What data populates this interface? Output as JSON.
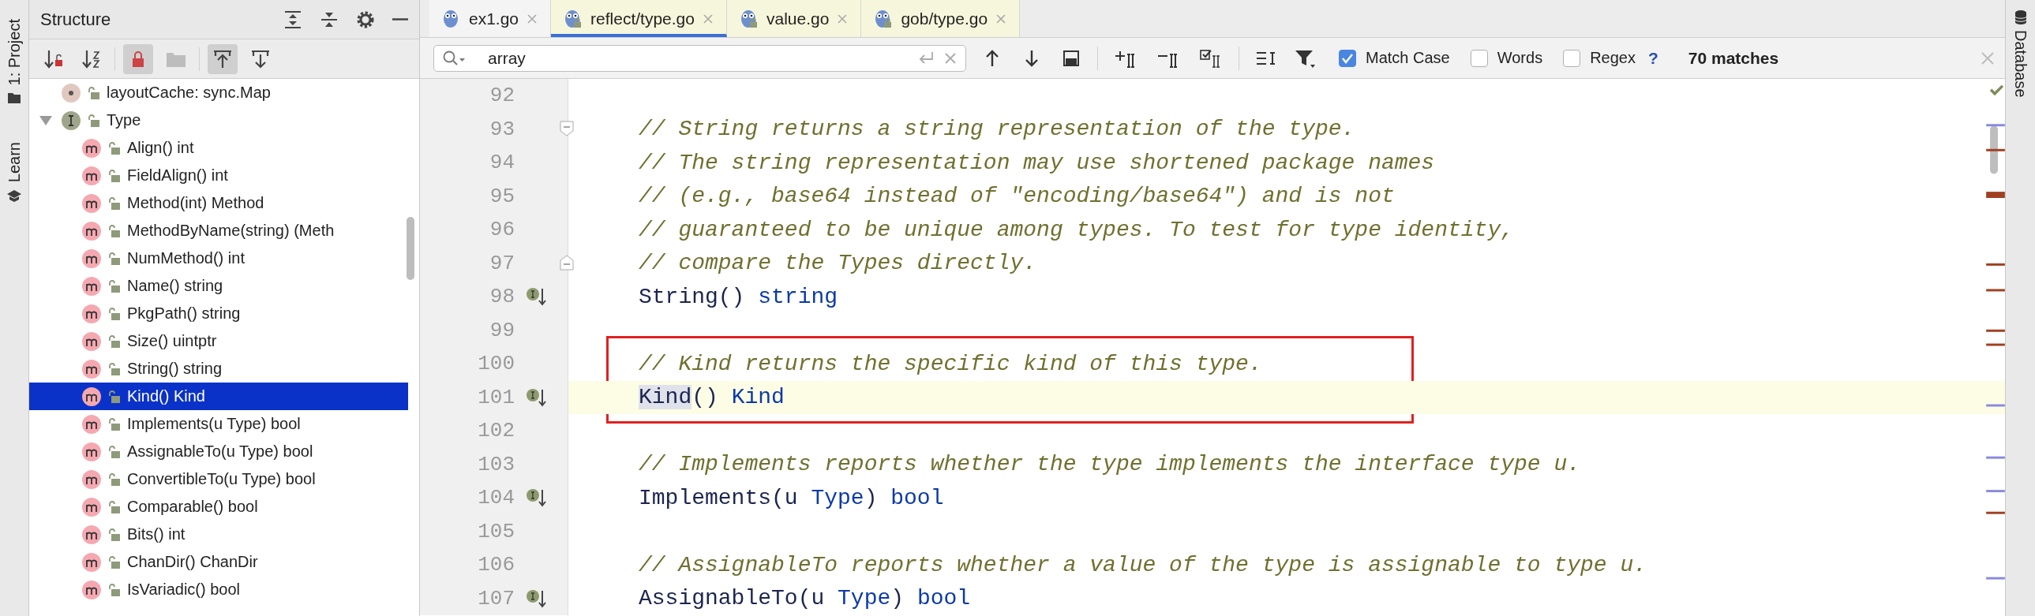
{
  "left_strip": [
    {
      "label": "1: Project",
      "kind": "project"
    },
    {
      "label": "Learn",
      "kind": "learn"
    }
  ],
  "structure": {
    "title": "Structure",
    "toolbar": [
      {
        "kind": "visibility",
        "selected": false
      },
      {
        "kind": "alpha",
        "selected": false
      },
      {
        "kind": "lock",
        "selected": true
      },
      {
        "kind": "folder",
        "selected": false
      },
      {
        "kind": "autoscroll",
        "selected": true
      },
      {
        "kind": "scrollto",
        "selected": false
      }
    ],
    "tree": [
      {
        "label": "layoutCache: sync.Map",
        "kind": "field",
        "selected": false
      },
      {
        "label": "Type",
        "kind": "interface",
        "selected": false,
        "expanded": true,
        "children": [
          {
            "label": "Align() int",
            "kind": "method",
            "selected": false
          },
          {
            "label": "FieldAlign() int",
            "kind": "method",
            "selected": false
          },
          {
            "label": "Method(int) Method",
            "kind": "method",
            "selected": false
          },
          {
            "label": "MethodByName(string) (Meth",
            "kind": "method",
            "selected": false
          },
          {
            "label": "NumMethod() int",
            "kind": "method",
            "selected": false
          },
          {
            "label": "Name() string",
            "kind": "method",
            "selected": false
          },
          {
            "label": "PkgPath() string",
            "kind": "method",
            "selected": false
          },
          {
            "label": "Size() uintptr",
            "kind": "method",
            "selected": false
          },
          {
            "label": "String() string",
            "kind": "method",
            "selected": false
          },
          {
            "label": "Kind() Kind",
            "kind": "method",
            "selected": true
          },
          {
            "label": "Implements(u Type) bool",
            "kind": "method",
            "selected": false
          },
          {
            "label": "AssignableTo(u Type) bool",
            "kind": "method",
            "selected": false
          },
          {
            "label": "ConvertibleTo(u Type) bool",
            "kind": "method",
            "selected": false
          },
          {
            "label": "Comparable() bool",
            "kind": "method",
            "selected": false
          },
          {
            "label": "Bits() int",
            "kind": "method",
            "selected": false
          },
          {
            "label": "ChanDir() ChanDir",
            "kind": "method",
            "selected": false
          },
          {
            "label": "IsVariadic() bool",
            "kind": "method",
            "selected": false
          }
        ]
      }
    ]
  },
  "tabs": [
    {
      "label": "ex1.go",
      "selected": false,
      "read_only": false
    },
    {
      "label": "reflect/type.go",
      "selected": true,
      "read_only": true
    },
    {
      "label": "value.go",
      "selected": false,
      "read_only": true
    },
    {
      "label": "gob/type.go",
      "selected": false,
      "read_only": true
    }
  ],
  "search": {
    "value": "array",
    "options": [
      {
        "label": "Match Case",
        "checked": true
      },
      {
        "label": "Words",
        "checked": false
      },
      {
        "label": "Regex",
        "checked": false
      }
    ],
    "help": "?",
    "matches": "70 matches"
  },
  "editor": {
    "lines": [
      {
        "number": "92"
      },
      {
        "number": "93",
        "fold_start": true,
        "tokens": [
          {
            "text": "// String returns a string representation of the type.",
            "kind": "comment"
          }
        ]
      },
      {
        "number": "94",
        "tokens": [
          {
            "text": "// The string representation may use shortened package names",
            "kind": "comment"
          }
        ]
      },
      {
        "number": "95",
        "tokens": [
          {
            "text": "// (e.g., base64 instead of \"encoding/base64\") and is not",
            "kind": "comment"
          }
        ]
      },
      {
        "number": "96",
        "tokens": [
          {
            "text": "// guaranteed to be unique among types. To test for type identity,",
            "kind": "comment"
          }
        ]
      },
      {
        "number": "97",
        "fold_end": true,
        "tokens": [
          {
            "text": "// compare the Types directly.",
            "kind": "comment"
          }
        ]
      },
      {
        "number": "98",
        "implemented": true,
        "tokens": [
          {
            "text": "String() ",
            "kind": "ident"
          },
          {
            "text": "string",
            "kind": "type"
          }
        ]
      },
      {
        "number": "99"
      },
      {
        "number": "100",
        "boxed": true,
        "tokens": [
          {
            "text": "// Kind returns the specific kind of this type.",
            "kind": "comment"
          }
        ]
      },
      {
        "number": "101",
        "boxed": true,
        "current": true,
        "implemented": true,
        "tokens": [
          {
            "text": "Kind",
            "kind": "ident",
            "highlighted": true
          },
          {
            "text": "() ",
            "kind": "ident"
          },
          {
            "text": "Kind",
            "kind": "type"
          }
        ]
      },
      {
        "number": "102"
      },
      {
        "number": "103",
        "tokens": [
          {
            "text": "// Implements reports whether the type implements the interface type u.",
            "kind": "comment"
          }
        ]
      },
      {
        "number": "104",
        "implemented": true,
        "tokens": [
          {
            "text": "Implements(u ",
            "kind": "ident"
          },
          {
            "text": "Type",
            "kind": "type"
          },
          {
            "text": ") ",
            "kind": "ident"
          },
          {
            "text": "bool",
            "kind": "type"
          }
        ]
      },
      {
        "number": "105"
      },
      {
        "number": "106",
        "tokens": [
          {
            "text": "// AssignableTo reports whether a value of the type is assignable to type u.",
            "kind": "comment"
          }
        ]
      },
      {
        "number": "107",
        "implemented": true,
        "tokens": [
          {
            "text": "AssignableTo(u ",
            "kind": "ident"
          },
          {
            "text": "Type",
            "kind": "type"
          },
          {
            "text": ") ",
            "kind": "ident"
          },
          {
            "text": "bool",
            "kind": "type"
          }
        ]
      }
    ]
  },
  "right_strip": {
    "label": "Database"
  }
}
